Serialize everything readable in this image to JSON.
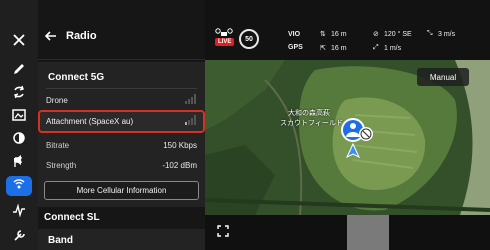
{
  "panel": {
    "title": "Radio",
    "sections": {
      "connect_5g": "Connect 5G",
      "connect_sl": "Connect SL",
      "band": "Band"
    },
    "rows": {
      "drone": "Drone",
      "attachment": "Attachment (SpaceX au)",
      "bitrate_label": "Bitrate",
      "bitrate_value": "150 Kbps",
      "strength_label": "Strength",
      "strength_value": "-102 dBm"
    },
    "more_button": "More Cellular Information"
  },
  "telemetry": {
    "live": "LIVE",
    "speed": "50",
    "vio": "VIO",
    "gps": "GPS",
    "height_up": "16 m",
    "distance": "16 m",
    "heading": "120 ° SE",
    "climb": "1 m/s",
    "horizontal_speed": "3 m/s"
  },
  "map": {
    "manual_button": "Manual",
    "place_label_1": "大和の森高萩",
    "place_label_2": "スカウトフィールド"
  },
  "colors": {
    "accent": "#1d6fe8",
    "highlight": "#d93025",
    "live": "#e02020"
  }
}
